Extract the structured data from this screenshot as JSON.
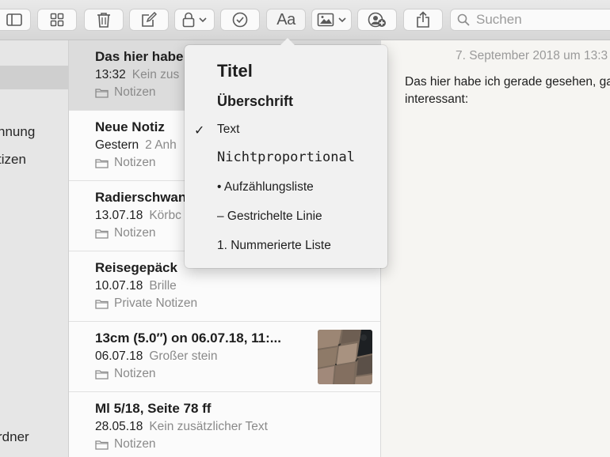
{
  "toolbar": {
    "font_button_label": "Aa",
    "search_placeholder": "Suchen"
  },
  "sidebar": {
    "items": [
      {
        "label": "hnung"
      },
      {
        "label": "tizen"
      },
      {
        "label": "rdner"
      }
    ]
  },
  "notes": [
    {
      "title": "Das hier habe",
      "date": "13:32",
      "snippet": "Kein zus",
      "folder": "Notizen",
      "selected": true
    },
    {
      "title": "Neue Notiz",
      "date": "Gestern",
      "snippet": "2 Anh",
      "folder": "Notizen"
    },
    {
      "title": "Radierschwan",
      "date": "13.07.18",
      "snippet": "Körbc",
      "folder": "Notizen"
    },
    {
      "title": "Reisegepäck",
      "date": "10.07.18",
      "snippet": "Brille",
      "folder": "Private Notizen"
    },
    {
      "title": "13cm (5.0″) on 06.07.18, 11:...",
      "date": "06.07.18",
      "snippet": "Großer stein",
      "folder": "Notizen",
      "has_thumbnail": true
    },
    {
      "title": "Ml 5/18, Seite 78 ff",
      "date": "28.05.18",
      "snippet": "Kein zusätzlicher Text",
      "folder": "Notizen"
    }
  ],
  "editor": {
    "date": "7. September 2018 um 13:3",
    "body": "Das hier habe ich gerade gesehen, ganz interessant:"
  },
  "format_menu": {
    "items": [
      {
        "label": "Titel"
      },
      {
        "label": "Überschrift"
      },
      {
        "label": "Text",
        "checked": true
      },
      {
        "label": "Nichtproportional"
      },
      {
        "label": "• Aufzählungsliste"
      },
      {
        "label": "– Gestrichelte Linie"
      },
      {
        "label": "1. Nummerierte Liste"
      }
    ],
    "check_mark": "✓"
  }
}
